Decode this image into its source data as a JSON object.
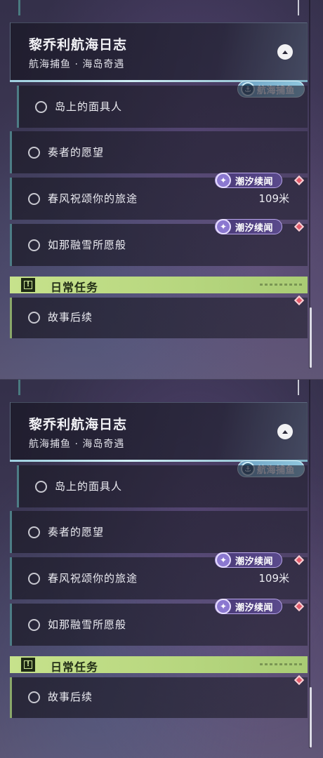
{
  "panels": [
    {
      "header": {
        "title": "黎乔利航海日志",
        "subtitle": "航海捕鱼 · 海岛奇遇"
      },
      "fishing_badge": {
        "label": "航海捕鱼",
        "icon": "anchor-icon"
      },
      "quests": [
        {
          "label": "岛上的面具人",
          "sub": true
        },
        {
          "label": "奏者的愿望"
        },
        {
          "label": "春风祝颂你的旅途",
          "distance": "109米",
          "tag": "潮汐续闻"
        },
        {
          "label": "如那融雪所愿般",
          "tag": "潮汐续闻"
        }
      ],
      "daily_section": {
        "title": "日常任务",
        "icon": "exclamation-icon"
      },
      "daily_quests": [
        {
          "label": "故事后续"
        }
      ]
    },
    {
      "header": {
        "title": "黎乔利航海日志",
        "subtitle": "航海捕鱼 · 海岛奇遇"
      },
      "fishing_badge": {
        "label": "航海捕鱼",
        "icon": "anchor-icon"
      },
      "quests": [
        {
          "label": "岛上的面具人",
          "sub": true
        },
        {
          "label": "奏者的愿望"
        },
        {
          "label": "春风祝颂你的旅途",
          "distance": "109米",
          "tag": "潮汐续闻"
        },
        {
          "label": "如那融雪所愿般",
          "tag": "潮汐续闻"
        }
      ],
      "daily_section": {
        "title": "日常任务",
        "icon": "exclamation-icon"
      },
      "daily_quests": [
        {
          "label": "故事后续"
        }
      ]
    }
  ],
  "colors": {
    "fishing_badge": "#8fc7de",
    "tide_badge": "#5a4a8c",
    "daily_section": "#c7e28c",
    "alert_diamond": "#e25a6a"
  }
}
